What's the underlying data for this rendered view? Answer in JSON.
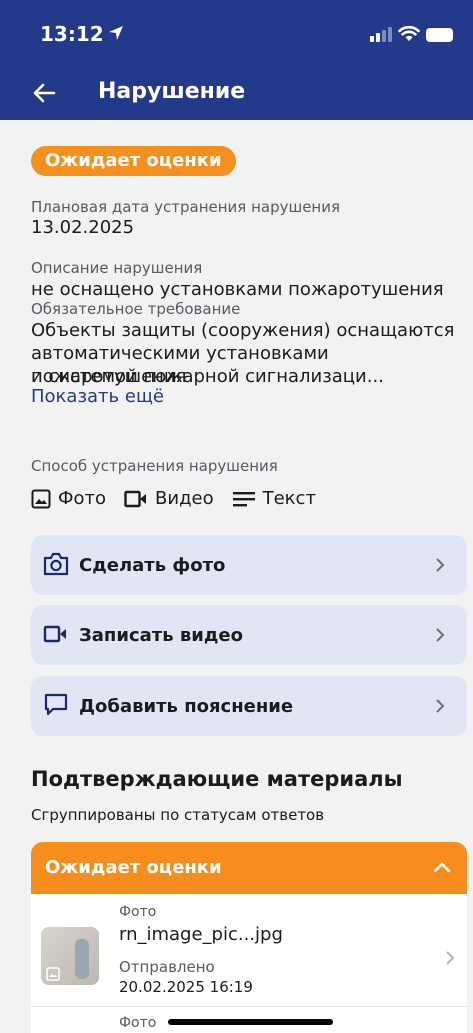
{
  "status_bar": {
    "time": "13:12"
  },
  "header": {
    "title": "Нарушение"
  },
  "status_badge": "Ожидает оценки",
  "details": {
    "due_date_label": "Плановая дата устранения нарушения",
    "due_date": "13.02.2025",
    "description_label": "Описание нарушения",
    "description": "не оснащено установками пожаротушения",
    "requirement_label": "Обязательное требование",
    "requirement_lines": [
      "Объекты защиты (сооружения) оснащаются",
      "автоматическими установками пожаротушения",
      "и системой пожарной сигнализаци..."
    ],
    "show_more": "Показать ещё"
  },
  "methods": {
    "label": "Способ устранения нарушения",
    "items": [
      {
        "icon": "image-icon",
        "label": "Фото"
      },
      {
        "icon": "video-icon",
        "label": "Видео"
      },
      {
        "icon": "text-lines-icon",
        "label": "Текст"
      }
    ]
  },
  "actions": [
    {
      "icon": "camera-icon",
      "label": "Сделать фото"
    },
    {
      "icon": "video-icon",
      "label": "Записать видео"
    },
    {
      "icon": "comment-icon",
      "label": "Добавить пояснение"
    }
  ],
  "materials": {
    "title": "Подтверждающие материалы",
    "subtitle": "Сгруппированы по статусам ответов",
    "group_title": "Ожидает оценки",
    "files": [
      {
        "type": "Фото",
        "name": "rn_image_pic...jpg",
        "sent_label": "Отправлено",
        "sent_date": "20.02.2025 16:19"
      },
      {
        "type": "Фото"
      }
    ]
  },
  "colors": {
    "header": "#233a8b",
    "accent_orange": "#f78d1b",
    "action_bg": "#e1e5f4",
    "link": "#233a8b"
  }
}
